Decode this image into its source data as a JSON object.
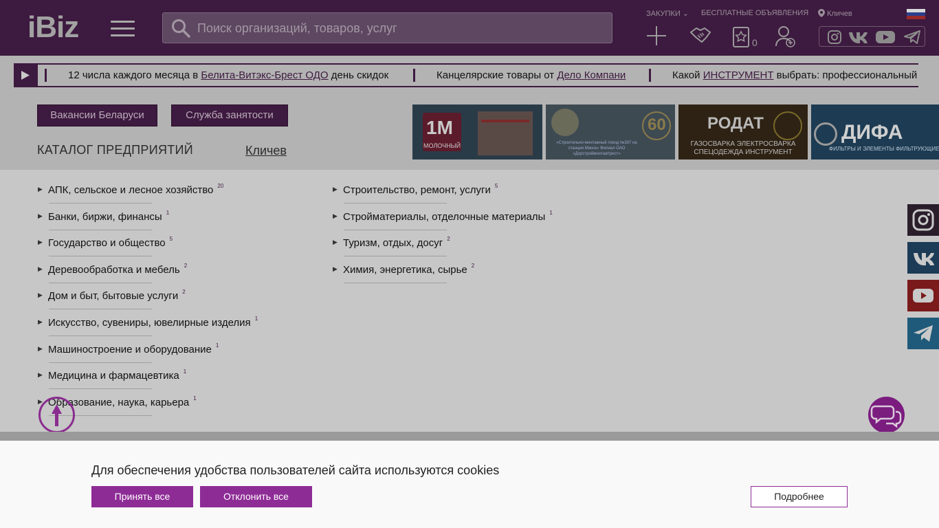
{
  "header": {
    "logo": "iBiz",
    "search_placeholder": "Поиск организаций, товаров, услуг",
    "links": {
      "purchases": "ЗАКУПКИ",
      "free_ads": "БЕСПЛАТНЫЕ ОБЪЯВЛЕНИЯ",
      "city": "Кличев"
    },
    "favorites_count": "0"
  },
  "ticker": [
    {
      "before": "12 числа каждого месяца в ",
      "link": "Белита-Витэкс-Брест ОДО",
      "after": " день скидок"
    },
    {
      "before": "Канцелярские товары от ",
      "link": "Дело Компани",
      "after": ""
    },
    {
      "before": "Какой ",
      "link": "ИНСТРУМЕНТ",
      "after": " выбрать: профессиональный и"
    }
  ],
  "catalog": {
    "btn_vacancies": "Вакансии Беларуси",
    "btn_employment": "Служба занятости",
    "title": "КАТАЛОГ ПРЕДПРИЯТИЙ",
    "city": "Кличев"
  },
  "banners": [
    {
      "title": "1М",
      "subtitle": "МОЛОЧНЫЙ"
    },
    {
      "title": "60",
      "subtitle": "«Строительно-монтажный поезд №397 на станции Минск» Филиал ОАО «Дорстроймонтажтрест»"
    },
    {
      "title": "РОДАТ",
      "subtitle": "ГАЗОСВАРКА ЭЛЕКТРОСВАРКА СПЕЦОДЕЖДА ИНСТРУМЕНТ"
    },
    {
      "title": "ДИФА",
      "subtitle": "ФИЛЬТРЫ И ЭЛЕМЕНТЫ ФИЛЬТРУЮЩИЕ"
    }
  ],
  "categories_left": [
    {
      "label": "АПК, сельское и лесное хозяйство",
      "count": "20"
    },
    {
      "label": "Банки, биржи, финансы",
      "count": "1"
    },
    {
      "label": "Государство и общество",
      "count": "5"
    },
    {
      "label": "Деревообработка и мебель",
      "count": "2"
    },
    {
      "label": "Дом и быт, бытовые услуги",
      "count": "2"
    },
    {
      "label": "Искусство, сувениры, ювелирные изделия",
      "count": "1"
    },
    {
      "label": "Машиностроение и оборудование",
      "count": "1"
    },
    {
      "label": "Медицина и фармацевтика",
      "count": "1"
    },
    {
      "label": "Образование, наука, карьера",
      "count": "1"
    }
  ],
  "categories_right": [
    {
      "label": "Строительство, ремонт, услуги",
      "count": "5"
    },
    {
      "label": "Стройматериалы, отделочные материалы",
      "count": "1"
    },
    {
      "label": "Туризм, отдых, досуг",
      "count": "2"
    },
    {
      "label": "Химия, энергетика, сырье",
      "count": "2"
    }
  ],
  "cookie": {
    "text": "Для обеспечения удобства пользователей сайта используются cookies",
    "accept": "Принять все",
    "reject": "Отклонить все",
    "more": "Подробнее"
  },
  "colors": {
    "brand": "#8e2c96",
    "header_bg": "#3d1a3f"
  }
}
